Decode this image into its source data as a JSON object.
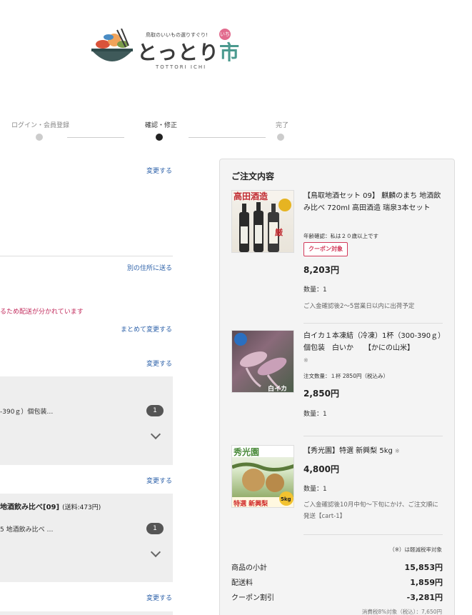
{
  "logo": {
    "tagline": "鳥取のいいもの選りすぐり!",
    "name_main": "とっとり",
    "name_ichi": "市",
    "badge": "いち",
    "roman": "TOTTORI ICHI"
  },
  "steps": [
    {
      "label": "ログイン・会員登録",
      "active": false
    },
    {
      "label": "確認・修正",
      "active": true
    },
    {
      "label": "完了",
      "active": false
    }
  ],
  "left": {
    "change_1": "変更する",
    "send_other": "別の住所に送る",
    "split_warning": "るため配送が分かれています",
    "change_all": "まとめて変更する",
    "change_2": "変更する",
    "box1_text": "-390ｇ）個包装…",
    "box1_count": "1",
    "change_3": "変更する",
    "box2_title": "地酒飲み比べ[09]",
    "box2_ship": "(送料:473円)",
    "box2_text": "5 地酒飲み比べ …",
    "box2_count": "1",
    "change_4": "変更する"
  },
  "summary": {
    "title": "ご注文内容",
    "items": [
      {
        "name": "【鳥取地酒セット 09】 麒麟のまち 地酒飲み比べ 720ml 高田酒造 瑞泉3本セット",
        "note": "年齢確認：私は２０歳以上です",
        "coupon": "クーポン対象",
        "price": "8,203円",
        "qty": "数量：1",
        "ship": "ご入金確認後2～5営業日以内に出荷予定",
        "img_label": "高田酒造"
      },
      {
        "name": "白イカ１本凍結（冷凍）1杯（300-390ｇ）個包装　白いか　　【かにの山米】",
        "mark": "※",
        "note": "注文数量：１杯 2850円（税込み）",
        "price": "2,850円",
        "qty": "数量：1",
        "img_label": "白イカ"
      },
      {
        "name": "【秀光園】特選 新興梨 5kg",
        "mark": "※",
        "price": "4,800円",
        "qty": "数量：1",
        "ship": "ご入金確認後10月中旬～下旬にかけ、ご注文順に発送【cart-1】",
        "img_label": "秀光園",
        "img_label2": "特選 新興梨",
        "img_badge": "5kg"
      }
    ],
    "tax_note": "（※）は軽減税率対象",
    "subtotal_label": "商品の小計",
    "subtotal": "15,853円",
    "shipping_label": "配送料",
    "shipping": "1,859円",
    "coupon_label": "クーポン割引",
    "coupon": "-3,281円",
    "tax_detail": "消費税8%対象（税込）：7,650円"
  },
  "colors": {
    "link": "#2a5fa8",
    "warning": "#c1285a",
    "coupon": "#d23a5a",
    "brand_teal": "#4b9a8f"
  }
}
